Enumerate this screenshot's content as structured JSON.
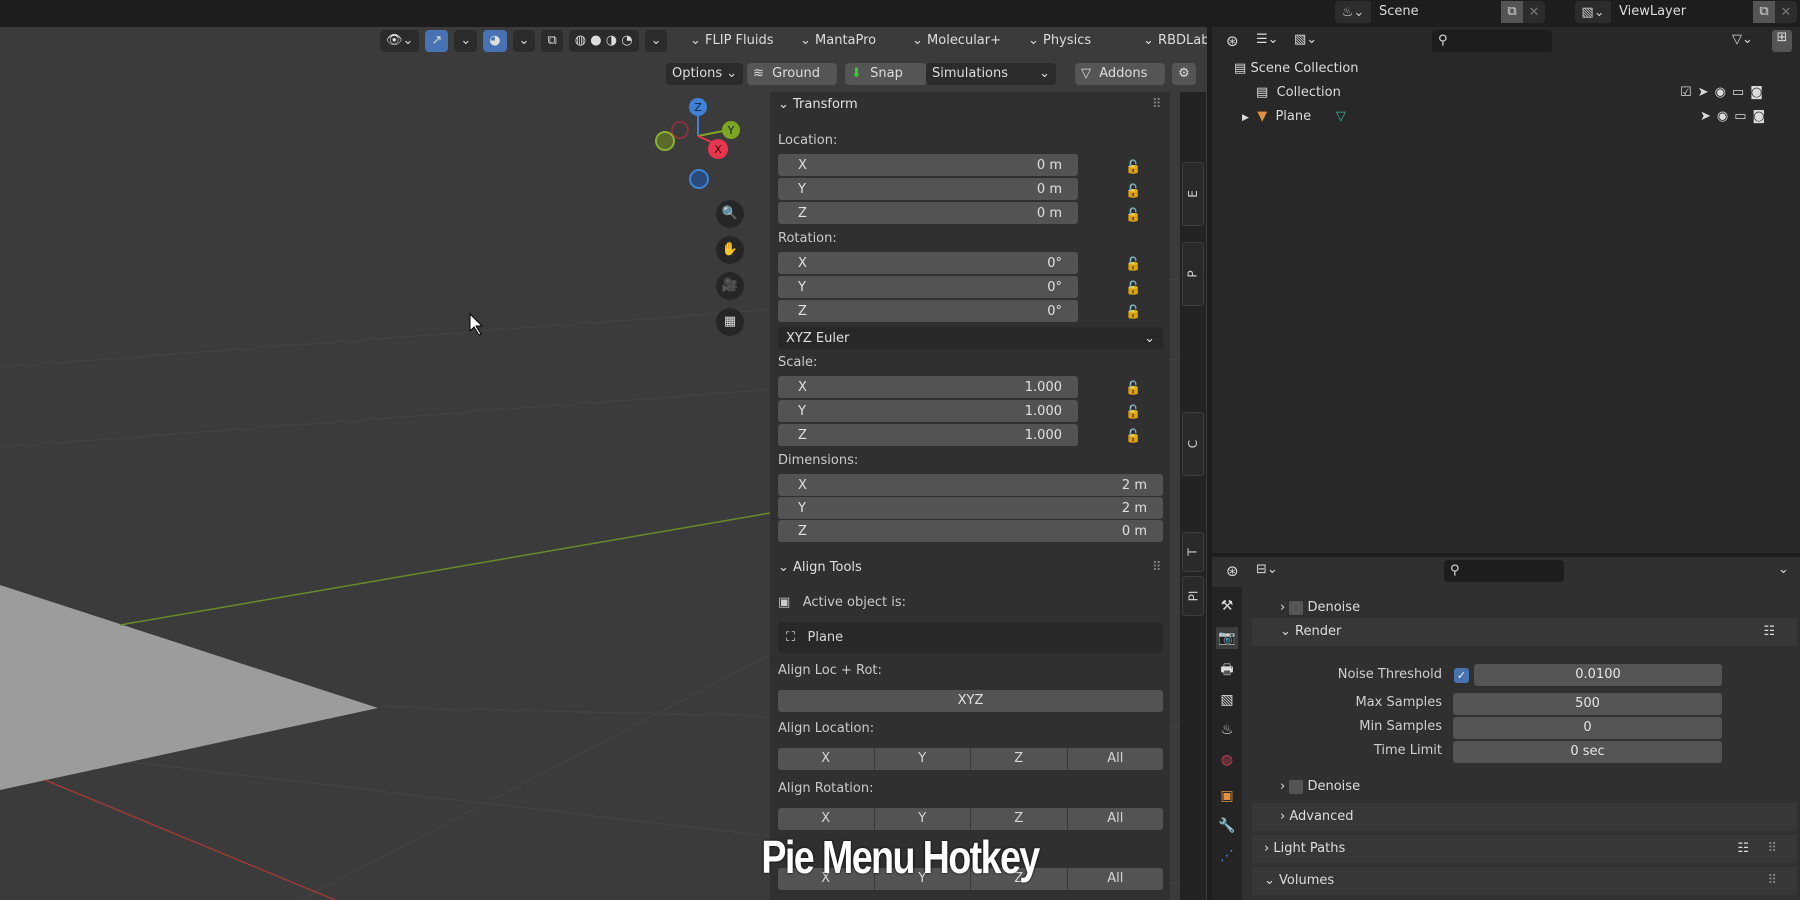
{
  "topbar": {
    "scene": "Scene",
    "view_layer": "ViewLayer"
  },
  "viewport": {
    "header_menus": [
      "FLIP Fluids",
      "MantaPro",
      "Molecular+",
      "Physics",
      "RBDLab"
    ],
    "options": "Options",
    "ground": "Ground",
    "snap": "Snap",
    "simulations": "Simulations",
    "addons": "Addons",
    "gizmo": {
      "x": "X",
      "y": "Y",
      "z": "Z"
    }
  },
  "npanel": {
    "transform": {
      "title": "Transform",
      "location_label": "Location:",
      "location": [
        {
          "axis": "X",
          "value": "0 m"
        },
        {
          "axis": "Y",
          "value": "0 m"
        },
        {
          "axis": "Z",
          "value": "0 m"
        }
      ],
      "rotation_label": "Rotation:",
      "rotation": [
        {
          "axis": "X",
          "value": "0°"
        },
        {
          "axis": "Y",
          "value": "0°"
        },
        {
          "axis": "Z",
          "value": "0°"
        }
      ],
      "rotation_mode": "XYZ Euler",
      "scale_label": "Scale:",
      "scale": [
        {
          "axis": "X",
          "value": "1.000"
        },
        {
          "axis": "Y",
          "value": "1.000"
        },
        {
          "axis": "Z",
          "value": "1.000"
        }
      ],
      "dimensions_label": "Dimensions:",
      "dimensions": [
        {
          "axis": "X",
          "value": "2 m"
        },
        {
          "axis": "Y",
          "value": "2 m"
        },
        {
          "axis": "Z",
          "value": "0 m"
        }
      ]
    },
    "align": {
      "title": "Align Tools",
      "active_label": "Active object is:",
      "active_object": "Plane",
      "locrot_label": "Align Loc + Rot:",
      "locrot_button": "XYZ",
      "location_label": "Align Location:",
      "rotation_label": "Align Rotation:",
      "buttons": [
        "X",
        "Y",
        "Z",
        "All"
      ]
    },
    "tabs": [
      "E",
      "P",
      "C",
      "T",
      "PI"
    ]
  },
  "outliner": {
    "items": [
      {
        "label": "Scene Collection"
      },
      {
        "label": "Collection"
      },
      {
        "label": "Plane"
      }
    ]
  },
  "properties": {
    "denoise1": "Denoise",
    "render": "Render",
    "noise_threshold_label": "Noise Threshold",
    "noise_threshold": "0.0100",
    "max_samples_label": "Max Samples",
    "max_samples": "500",
    "min_samples_label": "Min Samples",
    "min_samples": "0",
    "time_limit_label": "Time Limit",
    "time_limit": "0 sec",
    "denoise2": "Denoise",
    "advanced": "Advanced",
    "light_paths": "Light Paths",
    "volumes": "Volumes"
  },
  "overlay_caption": "Pie Menu Hotkey",
  "colors": {
    "accent": "#4772b3",
    "x_axis": "#e8364f",
    "y_axis": "#7ea623",
    "z_axis": "#3d82d6"
  }
}
